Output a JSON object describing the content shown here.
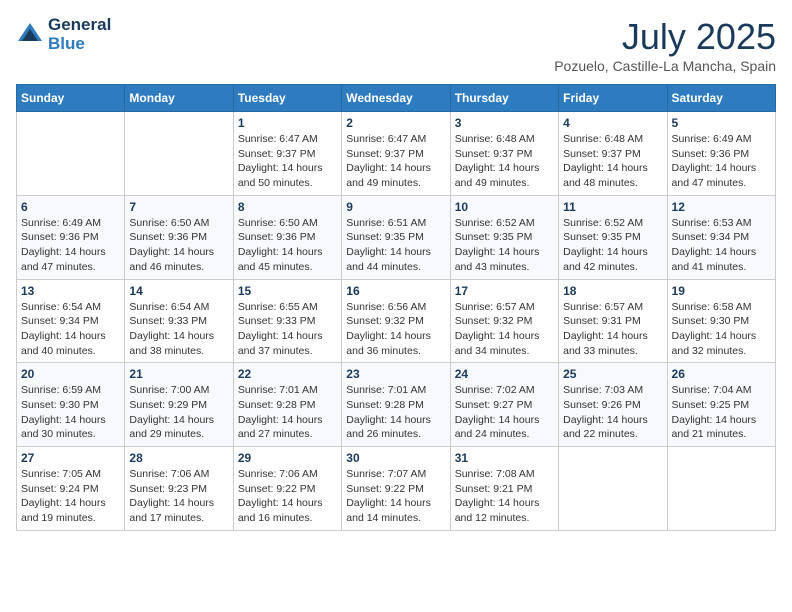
{
  "header": {
    "logo_line1": "General",
    "logo_line2": "Blue",
    "month": "July 2025",
    "location": "Pozuelo, Castille-La Mancha, Spain"
  },
  "weekdays": [
    "Sunday",
    "Monday",
    "Tuesday",
    "Wednesday",
    "Thursday",
    "Friday",
    "Saturday"
  ],
  "weeks": [
    [
      {
        "day": "",
        "detail": ""
      },
      {
        "day": "",
        "detail": ""
      },
      {
        "day": "1",
        "detail": "Sunrise: 6:47 AM\nSunset: 9:37 PM\nDaylight: 14 hours\nand 50 minutes."
      },
      {
        "day": "2",
        "detail": "Sunrise: 6:47 AM\nSunset: 9:37 PM\nDaylight: 14 hours\nand 49 minutes."
      },
      {
        "day": "3",
        "detail": "Sunrise: 6:48 AM\nSunset: 9:37 PM\nDaylight: 14 hours\nand 49 minutes."
      },
      {
        "day": "4",
        "detail": "Sunrise: 6:48 AM\nSunset: 9:37 PM\nDaylight: 14 hours\nand 48 minutes."
      },
      {
        "day": "5",
        "detail": "Sunrise: 6:49 AM\nSunset: 9:36 PM\nDaylight: 14 hours\nand 47 minutes."
      }
    ],
    [
      {
        "day": "6",
        "detail": "Sunrise: 6:49 AM\nSunset: 9:36 PM\nDaylight: 14 hours\nand 47 minutes."
      },
      {
        "day": "7",
        "detail": "Sunrise: 6:50 AM\nSunset: 9:36 PM\nDaylight: 14 hours\nand 46 minutes."
      },
      {
        "day": "8",
        "detail": "Sunrise: 6:50 AM\nSunset: 9:36 PM\nDaylight: 14 hours\nand 45 minutes."
      },
      {
        "day": "9",
        "detail": "Sunrise: 6:51 AM\nSunset: 9:35 PM\nDaylight: 14 hours\nand 44 minutes."
      },
      {
        "day": "10",
        "detail": "Sunrise: 6:52 AM\nSunset: 9:35 PM\nDaylight: 14 hours\nand 43 minutes."
      },
      {
        "day": "11",
        "detail": "Sunrise: 6:52 AM\nSunset: 9:35 PM\nDaylight: 14 hours\nand 42 minutes."
      },
      {
        "day": "12",
        "detail": "Sunrise: 6:53 AM\nSunset: 9:34 PM\nDaylight: 14 hours\nand 41 minutes."
      }
    ],
    [
      {
        "day": "13",
        "detail": "Sunrise: 6:54 AM\nSunset: 9:34 PM\nDaylight: 14 hours\nand 40 minutes."
      },
      {
        "day": "14",
        "detail": "Sunrise: 6:54 AM\nSunset: 9:33 PM\nDaylight: 14 hours\nand 38 minutes."
      },
      {
        "day": "15",
        "detail": "Sunrise: 6:55 AM\nSunset: 9:33 PM\nDaylight: 14 hours\nand 37 minutes."
      },
      {
        "day": "16",
        "detail": "Sunrise: 6:56 AM\nSunset: 9:32 PM\nDaylight: 14 hours\nand 36 minutes."
      },
      {
        "day": "17",
        "detail": "Sunrise: 6:57 AM\nSunset: 9:32 PM\nDaylight: 14 hours\nand 34 minutes."
      },
      {
        "day": "18",
        "detail": "Sunrise: 6:57 AM\nSunset: 9:31 PM\nDaylight: 14 hours\nand 33 minutes."
      },
      {
        "day": "19",
        "detail": "Sunrise: 6:58 AM\nSunset: 9:30 PM\nDaylight: 14 hours\nand 32 minutes."
      }
    ],
    [
      {
        "day": "20",
        "detail": "Sunrise: 6:59 AM\nSunset: 9:30 PM\nDaylight: 14 hours\nand 30 minutes."
      },
      {
        "day": "21",
        "detail": "Sunrise: 7:00 AM\nSunset: 9:29 PM\nDaylight: 14 hours\nand 29 minutes."
      },
      {
        "day": "22",
        "detail": "Sunrise: 7:01 AM\nSunset: 9:28 PM\nDaylight: 14 hours\nand 27 minutes."
      },
      {
        "day": "23",
        "detail": "Sunrise: 7:01 AM\nSunset: 9:28 PM\nDaylight: 14 hours\nand 26 minutes."
      },
      {
        "day": "24",
        "detail": "Sunrise: 7:02 AM\nSunset: 9:27 PM\nDaylight: 14 hours\nand 24 minutes."
      },
      {
        "day": "25",
        "detail": "Sunrise: 7:03 AM\nSunset: 9:26 PM\nDaylight: 14 hours\nand 22 minutes."
      },
      {
        "day": "26",
        "detail": "Sunrise: 7:04 AM\nSunset: 9:25 PM\nDaylight: 14 hours\nand 21 minutes."
      }
    ],
    [
      {
        "day": "27",
        "detail": "Sunrise: 7:05 AM\nSunset: 9:24 PM\nDaylight: 14 hours\nand 19 minutes."
      },
      {
        "day": "28",
        "detail": "Sunrise: 7:06 AM\nSunset: 9:23 PM\nDaylight: 14 hours\nand 17 minutes."
      },
      {
        "day": "29",
        "detail": "Sunrise: 7:06 AM\nSunset: 9:22 PM\nDaylight: 14 hours\nand 16 minutes."
      },
      {
        "day": "30",
        "detail": "Sunrise: 7:07 AM\nSunset: 9:22 PM\nDaylight: 14 hours\nand 14 minutes."
      },
      {
        "day": "31",
        "detail": "Sunrise: 7:08 AM\nSunset: 9:21 PM\nDaylight: 14 hours\nand 12 minutes."
      },
      {
        "day": "",
        "detail": ""
      },
      {
        "day": "",
        "detail": ""
      }
    ]
  ]
}
